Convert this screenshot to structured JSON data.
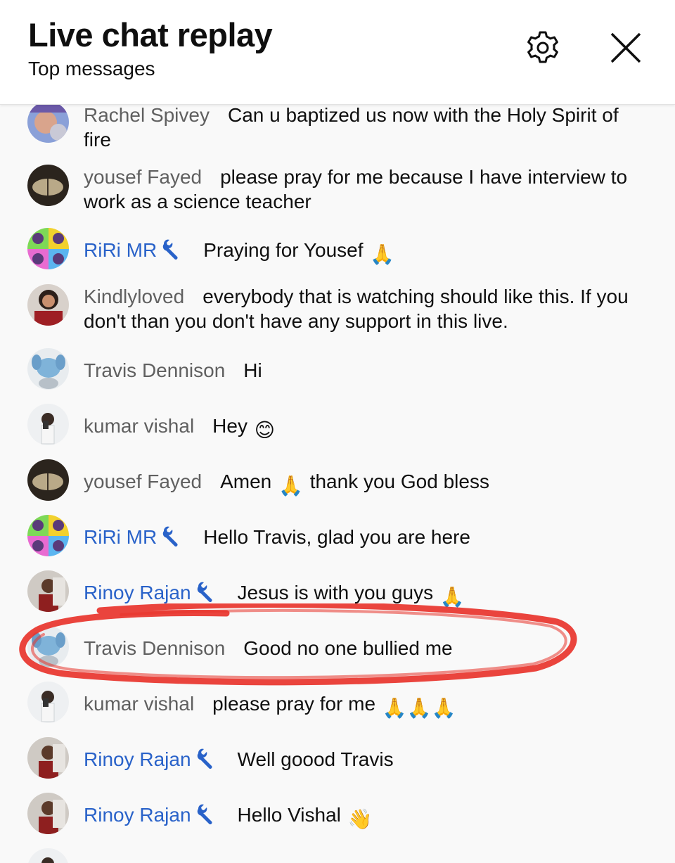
{
  "header": {
    "title": "Live chat replay",
    "subtitle": "Top messages",
    "settings_icon": "gear-icon",
    "close_icon": "close-icon"
  },
  "colors": {
    "moderator_name": "#2962c9",
    "author_name": "#606060",
    "annotation": "#e8342c",
    "background": "#f9f9f9"
  },
  "messages": [
    {
      "author": "Rachel Spivey",
      "text": "Can u baptized us now with the Holy Spirit of fire",
      "moderator": false
    },
    {
      "author": "yousef Fayed",
      "text": "please pray for me because I have interview to work as a science teacher",
      "moderator": false
    },
    {
      "author": "RiRi MR",
      "text": "Praying for Yousef",
      "moderator": true,
      "emoji": "🙏"
    },
    {
      "author": "Kindlyloved",
      "text": "everybody that is watching should like this. If you don't than you don't have any support in this live.",
      "moderator": false
    },
    {
      "author": "Travis Dennison",
      "text": "Hi",
      "moderator": false
    },
    {
      "author": "kumar vishal",
      "text": "Hey",
      "moderator": false,
      "emoji": "😊"
    },
    {
      "author": "yousef Fayed",
      "text_a": "Amen",
      "text_b": "thank you God bless",
      "moderator": false,
      "emoji": "🙏"
    },
    {
      "author": "RiRi MR",
      "text": "Hello Travis, glad you are here",
      "moderator": true
    },
    {
      "author": "Rinoy Rajan",
      "text": "Jesus is with you guys",
      "moderator": true,
      "emoji": "🙏"
    },
    {
      "author": "Travis Dennison",
      "text": "Good no one bullied me",
      "moderator": false,
      "highlighted": true
    },
    {
      "author": "kumar vishal",
      "text": "please pray for me",
      "moderator": false,
      "emoji": "🙏🙏🙏"
    },
    {
      "author": "Rinoy Rajan",
      "text": "Well goood Travis",
      "moderator": true
    },
    {
      "author": "Rinoy Rajan",
      "text": "Hello Vishal",
      "moderator": true,
      "emoji": "👋"
    }
  ]
}
